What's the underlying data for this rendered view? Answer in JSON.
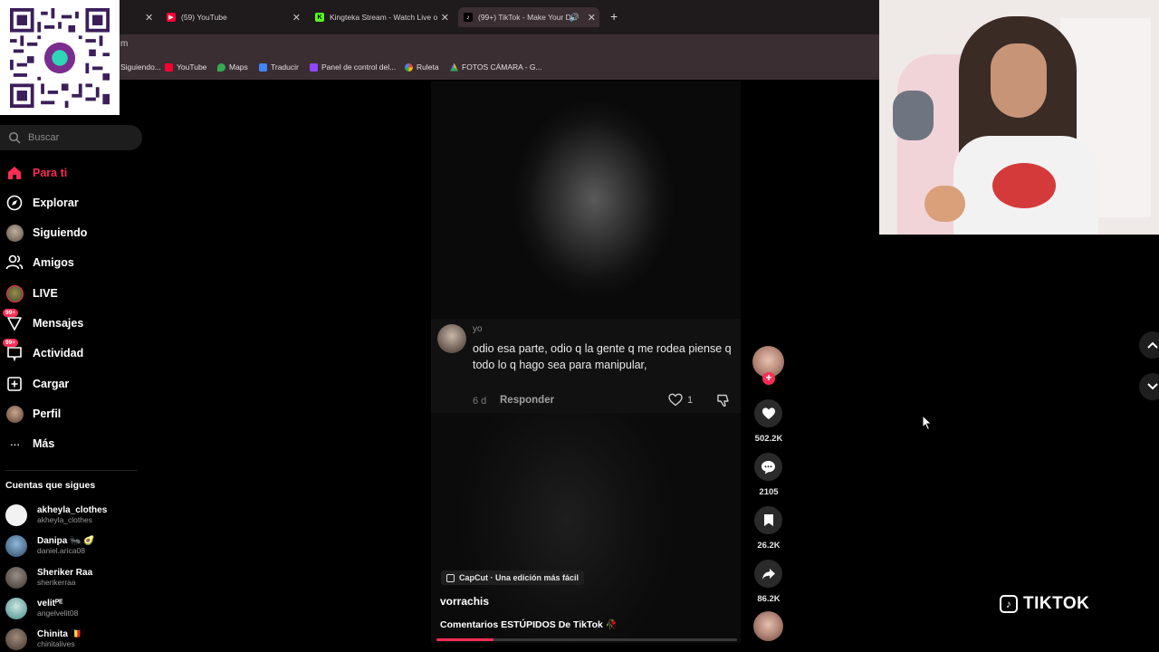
{
  "browser": {
    "tabs": [
      {
        "label": "(59) YouTube",
        "icon": "youtube-icon",
        "color": "#ff0033"
      },
      {
        "label": "Kingteka Stream - Watch Live o",
        "icon": "kick-icon",
        "color": "#53fc18"
      },
      {
        "label": "(99+) TikTok - Make Your D",
        "icon": "tiktok-icon",
        "color": "#ffffff"
      }
    ],
    "new_tab": "+",
    "url_fragment": "m",
    "bookmarks": [
      "Siguiendo...",
      "YouTube",
      "Maps",
      "Traducir",
      "Panel de control del...",
      "Ruleta",
      "FOTOS CÁMARA - G..."
    ]
  },
  "sidebar": {
    "search_placeholder": "Buscar",
    "nav": [
      {
        "label": "Para ti",
        "icon": "home-icon"
      },
      {
        "label": "Explorar",
        "icon": "compass-icon"
      },
      {
        "label": "Siguiendo",
        "icon": "following-avatar"
      },
      {
        "label": "Amigos",
        "icon": "friends-icon"
      },
      {
        "label": "LIVE",
        "icon": "live-icon"
      },
      {
        "label": "Mensajes",
        "icon": "messages-icon",
        "badge": "99+"
      },
      {
        "label": "Actividad",
        "icon": "activity-icon",
        "badge": "99+"
      },
      {
        "label": "Cargar",
        "icon": "upload-icon"
      },
      {
        "label": "Perfil",
        "icon": "profile-avatar"
      },
      {
        "label": "Más",
        "icon": "more-icon"
      }
    ],
    "following_title": "Cuentas que sigues",
    "accounts": [
      {
        "name": "akheyla_clothes",
        "handle": "akheyla_clothes"
      },
      {
        "name": "Danipa 🐜 🥑",
        "handle": "daniel.arica08"
      },
      {
        "name": "Sheriker Raa",
        "handle": "sherikerraa"
      },
      {
        "name": "velitᴾᴱ",
        "handle": "angelvelit08"
      },
      {
        "name": "Chinita 🇧🇪",
        "handle": "chinitalives"
      }
    ]
  },
  "video": {
    "comment": {
      "user": "yo",
      "text": "odio esa parte, odio q la gente q me rodea piense q todo lo q hago sea para manipular,",
      "time": "6 d",
      "reply_label": "Responder",
      "likes": "1"
    },
    "capcut_label": "CapCut · Una edición más fácil",
    "author": "vorrachis",
    "caption": "Comentarios ESTÚPIDOS De TikTok 🥀",
    "progress": 0.19
  },
  "actions": {
    "likes": "502.2K",
    "comments": "2105",
    "saves": "26.2K",
    "shares": "86.2K"
  },
  "watermark": "TIKTOK",
  "colors": {
    "accent": "#fe2c55",
    "browser_bar": "#3a2e33"
  }
}
